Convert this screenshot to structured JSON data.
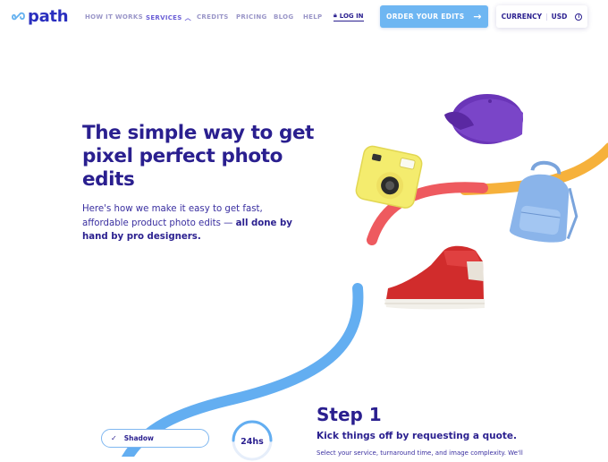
{
  "header": {
    "logo_text": "path",
    "nav": [
      {
        "label": "HOW IT WORKS"
      },
      {
        "label": "SERVICES"
      },
      {
        "label": "CREDITS"
      },
      {
        "label": "PRICING"
      },
      {
        "label": "BLOG"
      },
      {
        "label": "HELP"
      }
    ],
    "login_label": "LOG IN",
    "order_button": "ORDER YOUR EDITS",
    "currency_label": "CURRENCY",
    "currency_value": "USD",
    "icons": [
      "infinity-logo-icon",
      "chevron-down-icon",
      "lock-icon",
      "arrow-right-icon",
      "info-icon"
    ]
  },
  "hero": {
    "title": "The simple way to get pixel perfect photo edits",
    "description_plain": "Here's how we make it easy to get fast, affordable product photo edits — ",
    "description_bold": "all done by hand by pro designers."
  },
  "products": [
    "purple-cap",
    "yellow-instant-camera",
    "blue-backpack",
    "red-sneaker"
  ],
  "step": {
    "title": "Step 1",
    "subtitle": "Kick things off by requesting a quote.",
    "body": "Select your service, turnaround time, and image complexity. We'll",
    "service_option": "Shadow",
    "turnaround": "24hs"
  },
  "colors": {
    "brand": "#2a1f8f",
    "accent_blue": "#6eb6f2",
    "curve_red": "#ee5a5f",
    "curve_orange": "#f6b13b",
    "curve_blue": "#63aef1"
  }
}
